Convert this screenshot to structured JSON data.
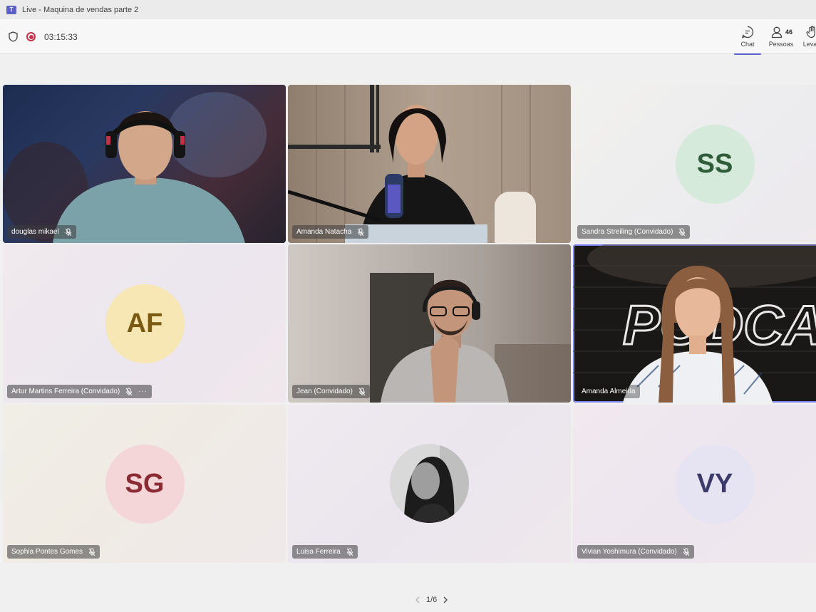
{
  "window": {
    "title": "Live - Maquina de vendas parte 2"
  },
  "toolbar": {
    "timer": "03:15:33",
    "chat_label": "Chat",
    "people_label": "Pessoas",
    "people_count": "46",
    "raise_label": "Levan"
  },
  "participants": [
    {
      "name": "douglas mikael",
      "type": "video"
    },
    {
      "name": "Amanda Natacha",
      "type": "video"
    },
    {
      "name": "Sandra Streiling (Convidado)",
      "initials": "SS",
      "type": "avatar",
      "avatar_bg": "#d6eadb",
      "avatar_fg": "#2f5d3a"
    },
    {
      "name": "Artur Martins Ferreira (Convidado)",
      "initials": "AF",
      "type": "avatar",
      "avatar_bg": "#f6e7b5",
      "avatar_fg": "#7a5a12",
      "more": "···"
    },
    {
      "name": "Jean (Convidado)",
      "type": "video"
    },
    {
      "name": "Amanda Almeida",
      "type": "video",
      "active": true,
      "sign_text": "PODCAP"
    },
    {
      "name": "Sophia Pontes Gomes",
      "initials": "SG",
      "type": "avatar",
      "avatar_bg": "#f4d6d8",
      "avatar_fg": "#8a2a32"
    },
    {
      "name": "Luisa Ferreira",
      "type": "photo"
    },
    {
      "name": "Vivian Yoshimura (Convidado)",
      "initials": "VY",
      "type": "avatar",
      "avatar_bg": "#e6e4f2",
      "avatar_fg": "#3b3a6b"
    }
  ],
  "pager": {
    "label": "1/6"
  },
  "colors": {
    "accent": "#5b5fc7",
    "record": "#c4314b"
  }
}
